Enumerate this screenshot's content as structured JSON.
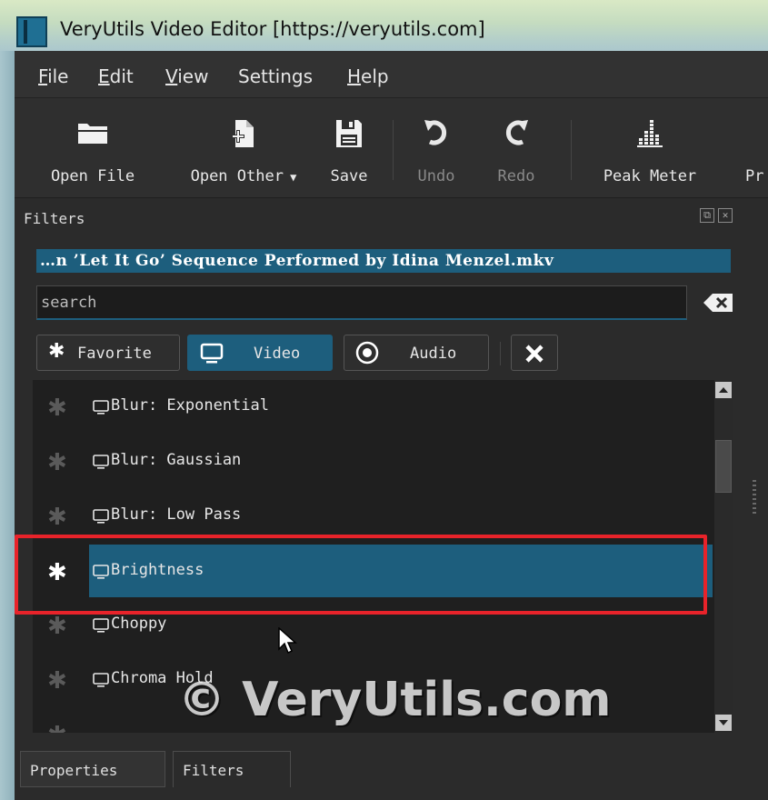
{
  "window": {
    "title": "VeryUtils Video Editor [https://veryutils.com]"
  },
  "menu": {
    "items": [
      {
        "label": "File",
        "underline": "F",
        "rest": "ile"
      },
      {
        "label": "Edit",
        "underline": "E",
        "rest": "dit"
      },
      {
        "label": "View",
        "underline": "V",
        "rest": "iew"
      },
      {
        "label": "Settings"
      },
      {
        "label": "Help",
        "underline": "H",
        "rest": "elp"
      }
    ]
  },
  "toolbar": {
    "open_file": "Open File",
    "open_other": "Open Other",
    "save": "Save",
    "undo": "Undo",
    "redo": "Redo",
    "peak_meter": "Peak Meter",
    "truncated": "Pr"
  },
  "filters_panel": {
    "title": "Filters",
    "clip_name": "…n ’Let It Go’ Sequence Performed by Idina Menzel.mkv",
    "search_placeholder": "search",
    "categories": {
      "favorite": "Favorite",
      "video": "Video",
      "audio": "Audio"
    },
    "items": [
      {
        "name": "Blur: Exponential",
        "selected": false
      },
      {
        "name": "Blur: Gaussian",
        "selected": false
      },
      {
        "name": "Blur: Low Pass",
        "selected": false
      },
      {
        "name": "Brightness",
        "selected": true
      },
      {
        "name": "Choppy",
        "selected": false
      },
      {
        "name": "Chroma Hold",
        "selected": false
      }
    ]
  },
  "bottom_tabs": {
    "properties": "Properties",
    "filters": "Filters"
  },
  "watermark": "© VeryUtils.com",
  "colors": {
    "accent": "#1d5e7d",
    "highlight": "#e8232a",
    "background": "#2b2b2b"
  }
}
